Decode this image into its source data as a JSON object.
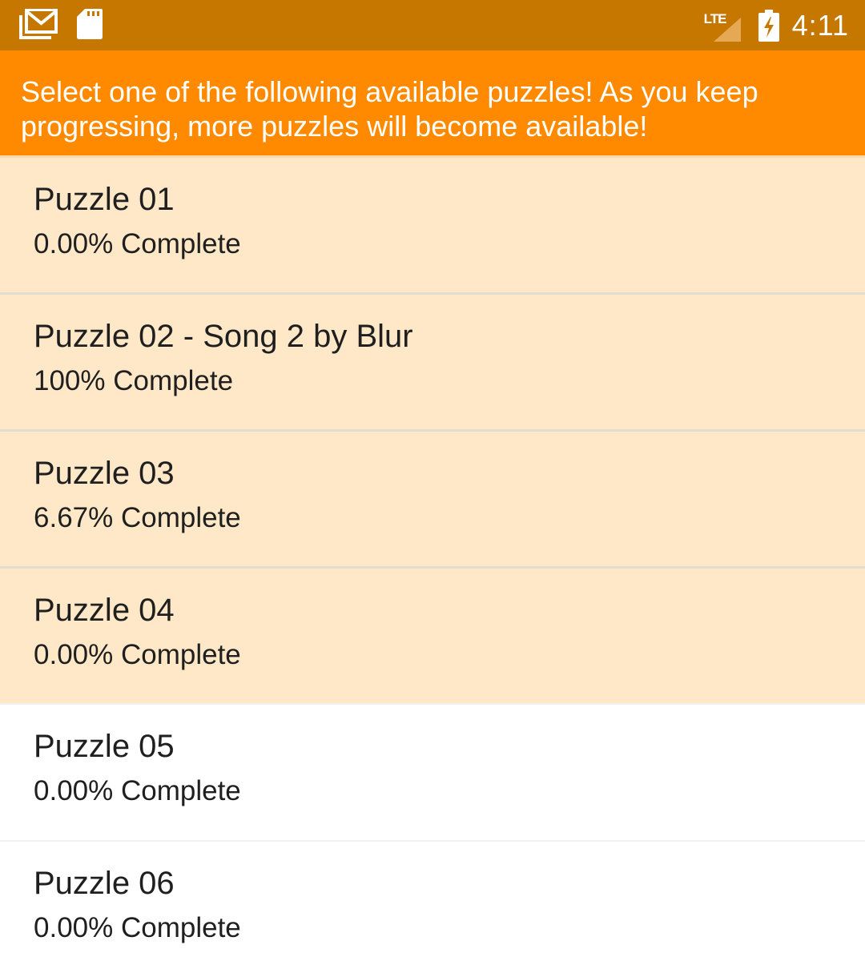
{
  "status_bar": {
    "left_icons": [
      "gmail-icon",
      "sd-card-icon"
    ],
    "network": "LTE",
    "battery_icon": "battery-charging-icon",
    "time": "4:11"
  },
  "header": {
    "message": "Select one of the following available puzzles! As you keep progressing, more puzzles will become available!"
  },
  "puzzles": [
    {
      "title": "Puzzle 01",
      "progress": "0.00% Complete",
      "available": true
    },
    {
      "title": "Puzzle 02 - Song 2 by Blur",
      "progress": "100% Complete",
      "available": true
    },
    {
      "title": "Puzzle 03",
      "progress": "6.67% Complete",
      "available": true
    },
    {
      "title": "Puzzle 04",
      "progress": "0.00% Complete",
      "available": true
    },
    {
      "title": "Puzzle 05",
      "progress": "0.00% Complete",
      "available": false
    },
    {
      "title": "Puzzle 06",
      "progress": "0.00% Complete",
      "available": false
    }
  ],
  "colors": {
    "status_bar": "#c67700",
    "header": "#ff8a00",
    "available_row": "#ffe8c8",
    "locked_row": "#ffffff"
  }
}
